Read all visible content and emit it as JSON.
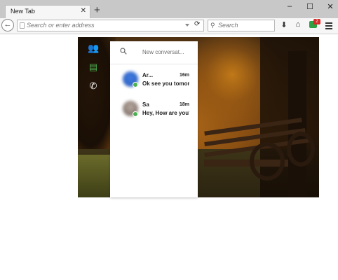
{
  "browser": {
    "tab_title": "New Tab",
    "tab_close": "✕",
    "new_tab": "+",
    "window_controls": {
      "minimize": "–",
      "maximize": "☐",
      "close": "✕"
    },
    "back": "←",
    "url_placeholder": "Search or enter address",
    "reload": "⟳",
    "search_placeholder": "Search",
    "download": "⬇",
    "home": "⌂",
    "extension_badge": "2"
  },
  "sidebar": {
    "icons": [
      "people-icon",
      "chat-icon",
      "phone-icon"
    ],
    "glyphs": {
      "people": "👥",
      "chat": "▤",
      "phone": "✆"
    },
    "active_color": "#4caf50"
  },
  "panel": {
    "search_placeholder": "New conversat...",
    "conversations": [
      {
        "name": "Ar...",
        "time": "16m",
        "message": "Ok see you tomorrow"
      },
      {
        "name": "Sa",
        "time": "18m",
        "message": "Hey, How are you?"
      }
    ]
  }
}
